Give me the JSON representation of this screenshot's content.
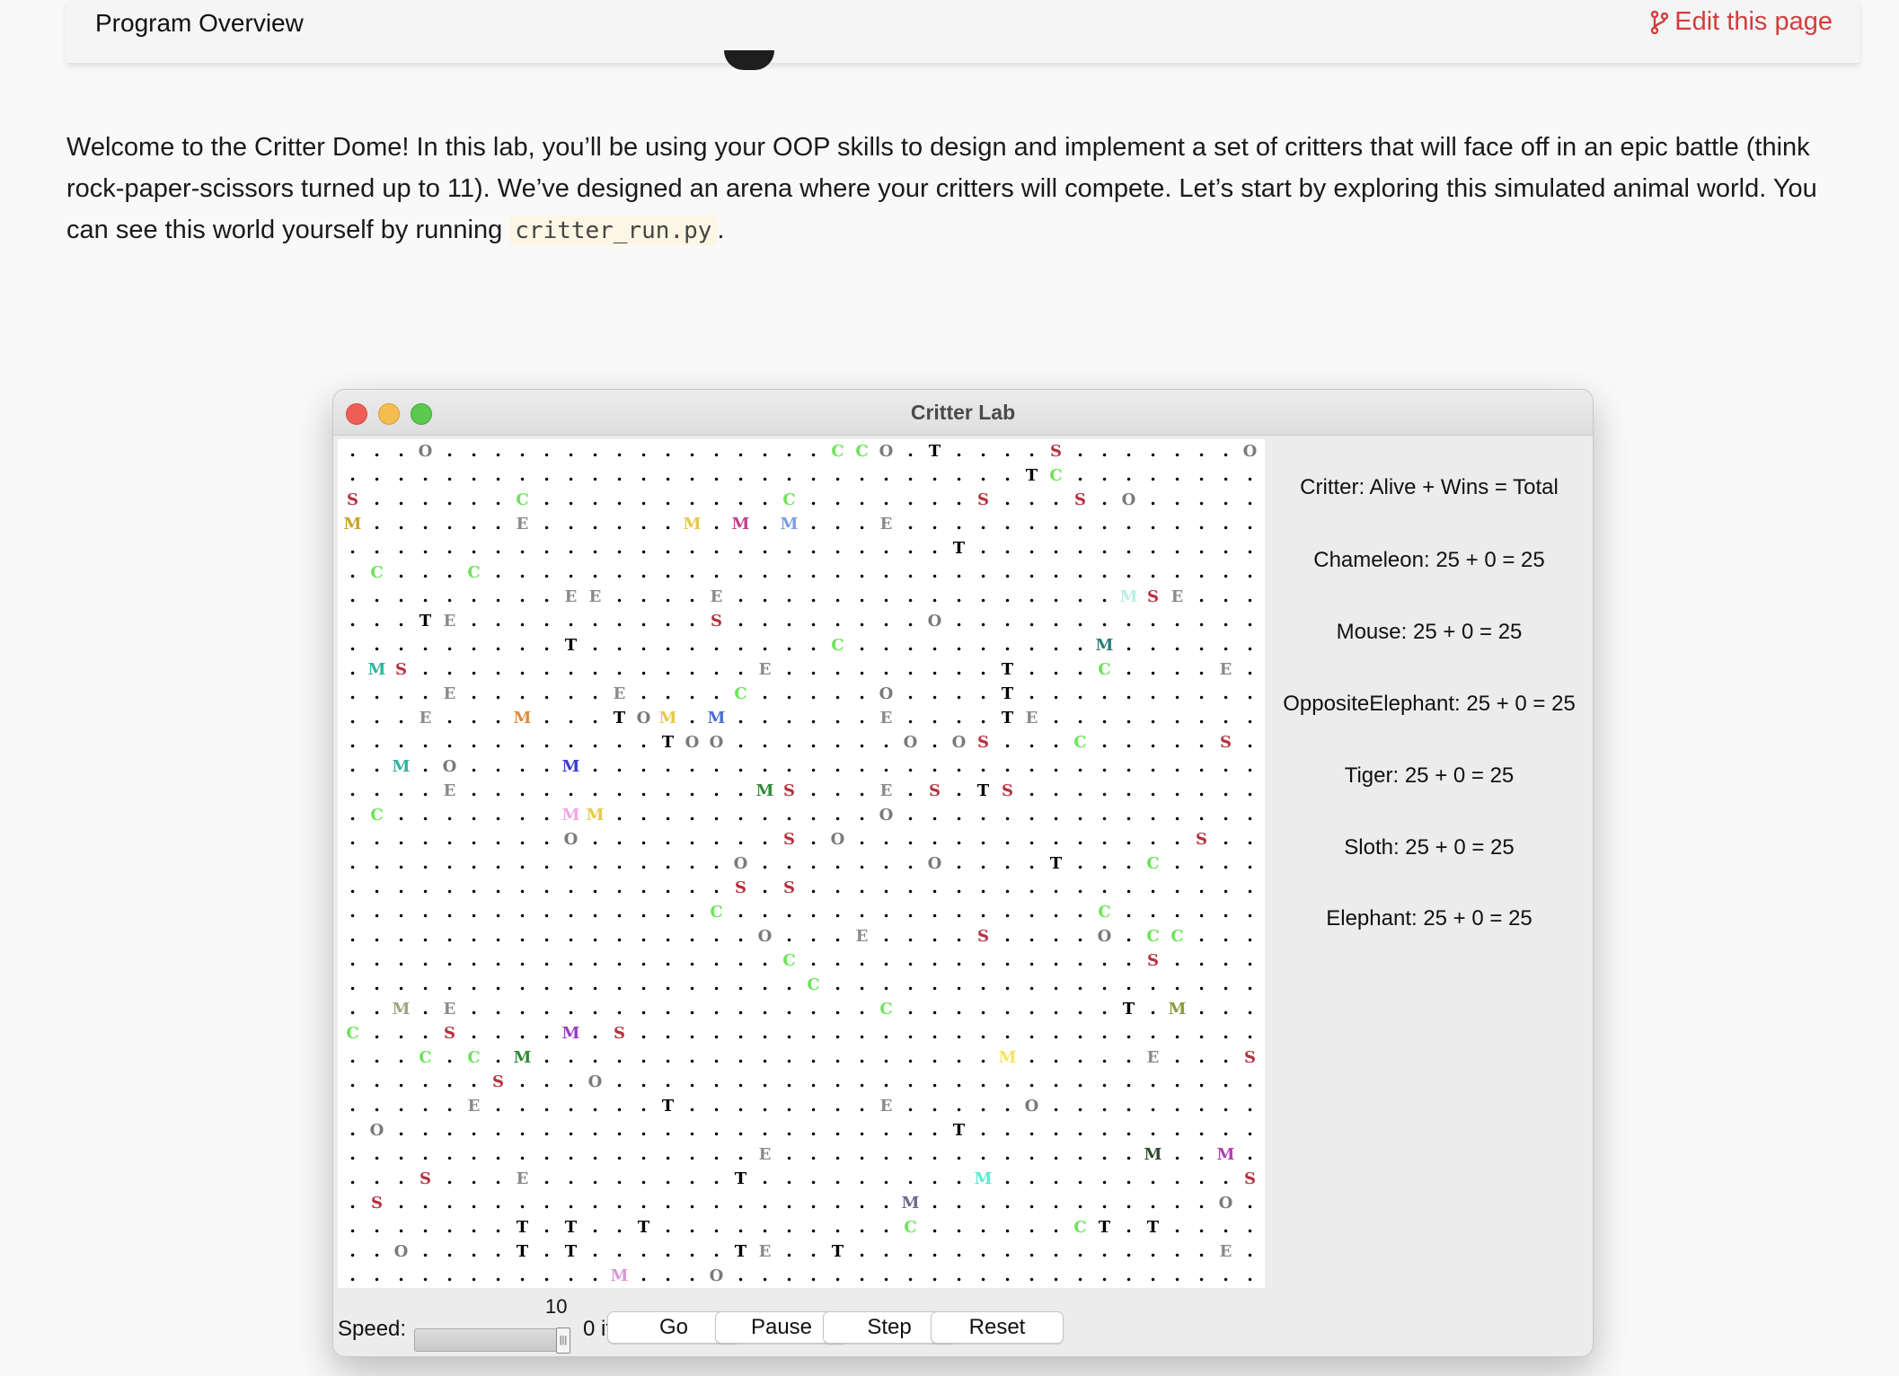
{
  "header": {
    "title": "Program Overview",
    "edit_label": "Edit this page",
    "edit_icon": "git-branch-icon",
    "accent_color": "#d33d3d"
  },
  "intro": {
    "text_before": "Welcome to the Critter Dome! In this lab, you’ll be using your OOP skills to design and implement a set of critters that will face off in an epic battle (think rock-paper-scissors turned up to 11). We’ve designed an arena where your critters will compete. Let’s start by exploring this simulated animal world. You can see this world yourself by running ",
    "code": "critter_run.py",
    "text_after": "."
  },
  "window": {
    "title": "Critter Lab",
    "traffic_lights": [
      "close",
      "minimize",
      "zoom"
    ]
  },
  "arena": {
    "empty_symbol": ".",
    "rows": [
      [
        "...O.................CCO.T....S........O"
      ],
      [
        "..............................TC........"
      ]
    ],
    "critters": [
      [
        0,
        3,
        "O"
      ],
      [
        0,
        20,
        "C"
      ],
      [
        0,
        21,
        "C"
      ],
      [
        0,
        22,
        "O"
      ],
      [
        0,
        24,
        "T"
      ],
      [
        0,
        29,
        "S"
      ],
      [
        0,
        37,
        "O"
      ],
      [
        1,
        28,
        "T"
      ],
      [
        1,
        29,
        "C"
      ],
      [
        2,
        0,
        "S"
      ],
      [
        2,
        7,
        "C"
      ],
      [
        2,
        18,
        "C"
      ],
      [
        2,
        26,
        "S"
      ],
      [
        2,
        30,
        "S"
      ],
      [
        2,
        32,
        "O"
      ],
      [
        3,
        0,
        "M"
      ],
      [
        3,
        7,
        "E"
      ],
      [
        3,
        14,
        "M"
      ],
      [
        3,
        16,
        "M"
      ],
      [
        3,
        18,
        "M"
      ],
      [
        3,
        22,
        "E"
      ],
      [
        4,
        25,
        "T"
      ],
      [
        5,
        1,
        "C"
      ],
      [
        5,
        5,
        "C"
      ],
      [
        6,
        9,
        "E"
      ],
      [
        6,
        10,
        "E"
      ],
      [
        6,
        15,
        "E"
      ],
      [
        6,
        32,
        "M"
      ],
      [
        6,
        33,
        "S"
      ],
      [
        6,
        34,
        "E"
      ],
      [
        7,
        3,
        "T"
      ],
      [
        7,
        4,
        "E"
      ],
      [
        7,
        15,
        "S"
      ],
      [
        7,
        24,
        "O"
      ],
      [
        8,
        9,
        "T"
      ],
      [
        8,
        20,
        "C"
      ],
      [
        8,
        31,
        "M"
      ],
      [
        9,
        1,
        "M"
      ],
      [
        9,
        2,
        "S"
      ],
      [
        9,
        17,
        "E"
      ],
      [
        9,
        27,
        "T"
      ],
      [
        9,
        31,
        "C"
      ],
      [
        9,
        36,
        "E"
      ],
      [
        10,
        4,
        "E"
      ],
      [
        10,
        11,
        "E"
      ],
      [
        10,
        16,
        "C"
      ],
      [
        10,
        22,
        "O"
      ],
      [
        10,
        27,
        "T"
      ],
      [
        11,
        3,
        "E"
      ],
      [
        11,
        7,
        "M"
      ],
      [
        11,
        11,
        "T"
      ],
      [
        11,
        12,
        "O"
      ],
      [
        11,
        13,
        "M"
      ],
      [
        11,
        15,
        "M"
      ],
      [
        11,
        22,
        "E"
      ],
      [
        11,
        27,
        "T"
      ],
      [
        11,
        28,
        "E"
      ],
      [
        12,
        13,
        "T"
      ],
      [
        12,
        14,
        "O"
      ],
      [
        12,
        15,
        "O"
      ],
      [
        12,
        23,
        "O"
      ],
      [
        12,
        25,
        "O"
      ],
      [
        12,
        26,
        "S"
      ],
      [
        12,
        30,
        "C"
      ],
      [
        12,
        36,
        "S"
      ],
      [
        13,
        2,
        "M"
      ],
      [
        13,
        4,
        "O"
      ],
      [
        13,
        9,
        "M"
      ],
      [
        14,
        4,
        "E"
      ],
      [
        14,
        17,
        "M"
      ],
      [
        14,
        18,
        "S"
      ],
      [
        14,
        22,
        "E"
      ],
      [
        14,
        24,
        "S"
      ],
      [
        14,
        26,
        "T"
      ],
      [
        14,
        27,
        "S"
      ],
      [
        15,
        1,
        "C"
      ],
      [
        15,
        9,
        "M"
      ],
      [
        15,
        10,
        "M"
      ],
      [
        15,
        22,
        "O"
      ],
      [
        16,
        9,
        "O"
      ],
      [
        16,
        18,
        "S"
      ],
      [
        16,
        20,
        "O"
      ],
      [
        16,
        35,
        "S"
      ],
      [
        17,
        16,
        "O"
      ],
      [
        17,
        24,
        "O"
      ],
      [
        17,
        29,
        "T"
      ],
      [
        17,
        33,
        "C"
      ],
      [
        18,
        16,
        "S"
      ],
      [
        18,
        18,
        "S"
      ],
      [
        19,
        15,
        "C"
      ],
      [
        19,
        31,
        "C"
      ],
      [
        20,
        17,
        "O"
      ],
      [
        20,
        21,
        "E"
      ],
      [
        20,
        26,
        "S"
      ],
      [
        20,
        31,
        "O"
      ],
      [
        20,
        33,
        "C"
      ],
      [
        20,
        34,
        "C"
      ],
      [
        21,
        18,
        "C"
      ],
      [
        21,
        33,
        "S"
      ],
      [
        22,
        19,
        "C"
      ],
      [
        23,
        2,
        "M"
      ],
      [
        23,
        4,
        "E"
      ],
      [
        23,
        22,
        "C"
      ],
      [
        23,
        32,
        "T"
      ],
      [
        23,
        34,
        "M"
      ],
      [
        24,
        0,
        "C"
      ],
      [
        24,
        4,
        "S"
      ],
      [
        24,
        9,
        "M"
      ],
      [
        24,
        11,
        "S"
      ],
      [
        25,
        3,
        "C"
      ],
      [
        25,
        5,
        "C"
      ],
      [
        25,
        7,
        "M"
      ],
      [
        25,
        27,
        "M"
      ],
      [
        25,
        33,
        "E"
      ],
      [
        25,
        37,
        "S"
      ],
      [
        26,
        6,
        "S"
      ],
      [
        26,
        10,
        "O"
      ],
      [
        27,
        5,
        "E"
      ],
      [
        27,
        13,
        "T"
      ],
      [
        27,
        22,
        "E"
      ],
      [
        27,
        28,
        "O"
      ],
      [
        28,
        1,
        "O"
      ],
      [
        28,
        25,
        "T"
      ],
      [
        29,
        17,
        "E"
      ],
      [
        29,
        33,
        "M"
      ],
      [
        29,
        36,
        "M"
      ],
      [
        30,
        3,
        "S"
      ],
      [
        30,
        7,
        "E"
      ],
      [
        30,
        16,
        "T"
      ],
      [
        30,
        26,
        "M"
      ],
      [
        30,
        37,
        "S"
      ],
      [
        31,
        1,
        "S"
      ],
      [
        31,
        23,
        "M"
      ],
      [
        31,
        36,
        "O"
      ],
      [
        32,
        7,
        "T"
      ],
      [
        32,
        9,
        "T"
      ],
      [
        32,
        12,
        "T"
      ],
      [
        32,
        23,
        "C"
      ],
      [
        32,
        30,
        "C"
      ],
      [
        32,
        31,
        "T"
      ],
      [
        32,
        33,
        "T"
      ],
      [
        33,
        2,
        "O"
      ],
      [
        33,
        7,
        "T"
      ],
      [
        33,
        9,
        "T"
      ],
      [
        33,
        16,
        "T"
      ],
      [
        33,
        17,
        "E"
      ],
      [
        33,
        20,
        "T"
      ],
      [
        33,
        36,
        "E"
      ],
      [
        34,
        11,
        "M"
      ],
      [
        34,
        15,
        "O"
      ]
    ],
    "mouse_colors": {
      "3,0": "#c9a227",
      "3,14": "#e8c84a",
      "3,16": "#c2408f",
      "3,18": "#7b9fe0",
      "6,32": "#b9f0e3",
      "8,31": "#2d7d7a",
      "9,1": "#2fb3a0",
      "11,7": "#e08a3c",
      "11,13": "#e8c84a",
      "11,15": "#4a6fd6",
      "13,2": "#2fb3a0",
      "13,9": "#3b3bd6",
      "14,17": "#2e8b3a",
      "15,9": "#f6a5e6",
      "15,10": "#e8c84a",
      "23,2": "#9aa87c",
      "23,34": "#8a9a3a",
      "24,9": "#9b3bc6",
      "25,7": "#2e8b3a",
      "25,27": "#f6e35a",
      "29,33": "#2d4a2d",
      "29,36": "#b23bb2",
      "30,26": "#5ee8d6",
      "31,23": "#6a6a8a",
      "34,11": "#d49ad4"
    },
    "colors": {
      "S": "#b5333f",
      "C": "#6de35a",
      "O": "#7a7a7a",
      "E": "#8a8a8a",
      "T": "#000000"
    }
  },
  "sidepanel": {
    "header": "Critter: Alive + Wins = Total",
    "stats": [
      "Chameleon: 25 + 0 = 25",
      "Mouse: 25 + 0 = 25",
      "OppositeElephant: 25 + 0 = 25",
      "Tiger: 25 + 0 = 25",
      "Sloth: 25 + 0 = 25",
      "Elephant: 25 + 0 = 25"
    ]
  },
  "controls": {
    "speed_label": "Speed:",
    "speed_value": "10",
    "speed_fraction": 1.0,
    "iterations": "0 iterations",
    "go": "Go",
    "pause": "Pause",
    "step": "Step",
    "reset": "Reset"
  }
}
